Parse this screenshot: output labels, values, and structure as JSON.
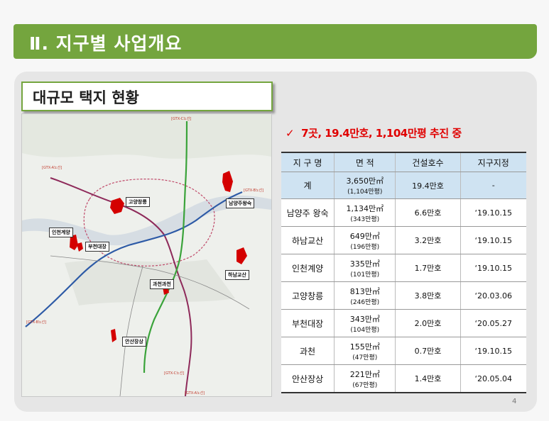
{
  "title": "Ⅱ. 지구별 사업개요",
  "section_title": "대규모 택지 현황",
  "note": {
    "check": "✓",
    "text": "7곳, 19.4만호, 1,104만평 추진 중"
  },
  "table": {
    "headers": [
      "지 구 명",
      "면 적",
      "건설호수",
      "지구지정"
    ],
    "total": {
      "name": "계",
      "area": "3,650만㎡",
      "area_pyeong": "(1,104만평)",
      "houses": "19.4만호",
      "date": "-"
    },
    "rows": [
      {
        "name": "남양주 왕숙",
        "area": "1,134만㎡",
        "area_pyeong": "(343만평)",
        "houses": "6.6만호",
        "date": "‘19.10.15"
      },
      {
        "name": "하남교산",
        "area": "649만㎡",
        "area_pyeong": "(196만평)",
        "houses": "3.2만호",
        "date": "‘19.10.15"
      },
      {
        "name": "인천계양",
        "area": "335만㎡",
        "area_pyeong": "(101만평)",
        "houses": "1.7만호",
        "date": "‘19.10.15"
      },
      {
        "name": "고양창릉",
        "area": "813만㎡",
        "area_pyeong": "(246만평)",
        "houses": "3.8만호",
        "date": "‘20.03.06"
      },
      {
        "name": "부천대장",
        "area": "343만㎡",
        "area_pyeong": "(104만평)",
        "houses": "2.0만호",
        "date": "‘20.05.27"
      },
      {
        "name": "과천",
        "area": "155만㎡",
        "area_pyeong": "(47만평)",
        "houses": "0.7만호",
        "date": "‘19.10.15"
      },
      {
        "name": "안산장상",
        "area": "221만㎡",
        "area_pyeong": "(67만평)",
        "houses": "1.4만호",
        "date": "‘20.05.04"
      }
    ]
  },
  "map": {
    "labels": {
      "goyang": "고양창릉",
      "namyangju": "남양주왕숙",
      "incheon": "인천계양",
      "bucheon": "부천대장",
      "hanam": "하남교산",
      "gwacheon": "과천과천",
      "ansan": "안산장상"
    },
    "gtx": {
      "c_top": "[GTX-C노선]",
      "a_left": "[GTX-A노선]",
      "b_right": "[GTX-B노선]",
      "b_left": "[GTX-B노선]",
      "c_bottom": "[GTX-C노선]",
      "a_bottom": "[GTX-A노선]"
    },
    "colors": {
      "gtx_a": "#8e2a5a",
      "gtx_b": "#2d5aa6",
      "gtx_c": "#3aa33a",
      "site": "#d40000"
    }
  },
  "page_number": "4",
  "colors": {
    "accent": "#74a53e",
    "header_fill": "#cfe3f2",
    "alert": "#e00000"
  }
}
